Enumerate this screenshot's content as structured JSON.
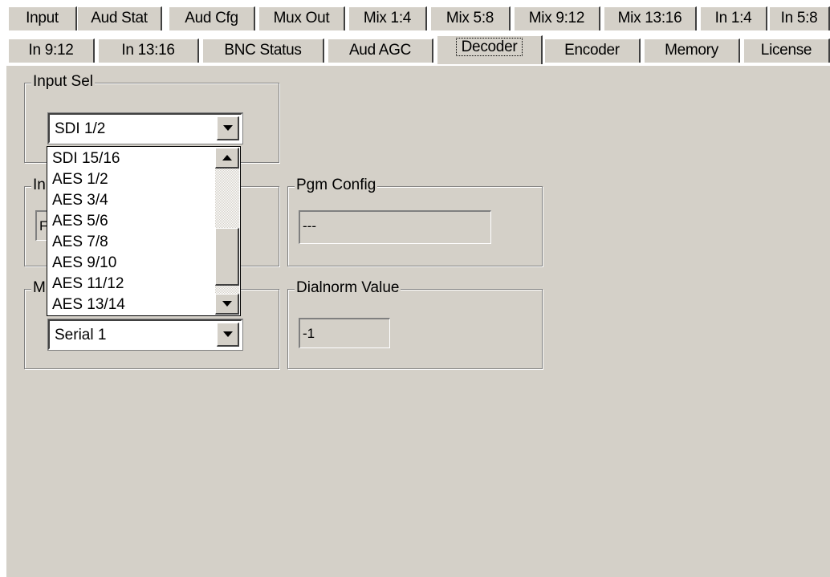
{
  "tabs_row1": [
    "Input",
    "Aud Stat",
    "Aud Cfg",
    "Mux Out",
    "Mix 1:4",
    "Mix 5:8",
    "Mix 9:12",
    "Mix 13:16",
    "In 1:4",
    "In 5:8"
  ],
  "tabs_row2": [
    "In 9:12",
    "In 13:16",
    "BNC Status",
    "Aud AGC",
    "Decoder",
    "Encoder",
    "Memory",
    "License"
  ],
  "selected_tab": "Decoder",
  "input_sel": {
    "legend": "Input Sel",
    "value": "SDI 1/2"
  },
  "input_group_partial_label": "In",
  "input_field_partial_value": "F",
  "mode_group_partial_label": "M",
  "serial": {
    "value": "Serial 1"
  },
  "pgm_config": {
    "legend": "Pgm Config",
    "value": "---"
  },
  "dialnorm": {
    "legend": "Dialnorm Value",
    "value": "-1"
  },
  "dropdown_options": [
    "SDI 15/16",
    "AES 1/2",
    "AES 3/4",
    "AES 5/6",
    "AES 7/8",
    "AES 9/10",
    "AES 11/12",
    "AES 13/14"
  ],
  "colors": {
    "window_face": "#d4d0c8",
    "highlight": "#ffffff",
    "shadow": "#808080"
  }
}
